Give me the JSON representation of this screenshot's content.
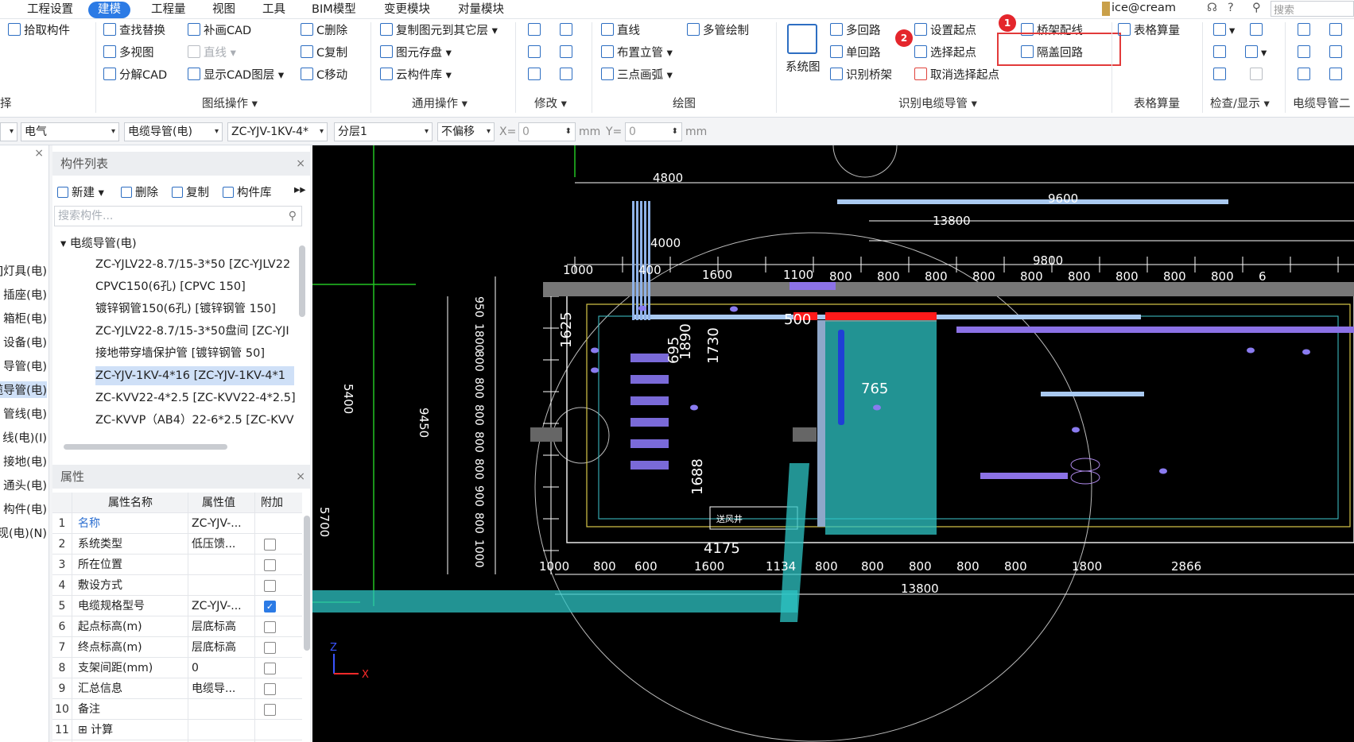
{
  "menubar": {
    "items": [
      "工程设置",
      "建模",
      "工程量",
      "视图",
      "工具",
      "BIM模型",
      "变更模块",
      "对量模块"
    ],
    "user": "ice@cream",
    "help": "?",
    "search_placeholder": "搜索"
  },
  "ribbon": {
    "pick": "拾取构件",
    "drawing_ops": {
      "find_replace": "查找替换",
      "supplement_cad": "补画CAD",
      "delete_c": "C删除",
      "multiview": "多视图",
      "line": "直线",
      "copy_c": "C复制",
      "explode_cad": "分解CAD",
      "show_cad_layer": "显示CAD图层",
      "move_c": "C移动",
      "group": "图纸操作"
    },
    "common_ops": {
      "copy_to_floor": "复制图元到其它层",
      "save_element": "图元存盘",
      "cloud_lib": "云构件库",
      "group": "通用操作"
    },
    "modify": {
      "group": "修改"
    },
    "draw": {
      "line": "直线",
      "riser": "布置立管",
      "arc": "三点画弧",
      "multi_pipe": "多管绘制",
      "group": "绘图"
    },
    "recognize": {
      "system_diagram": "系统图",
      "multi_loop": "多回路",
      "single_loop": "单回路",
      "recognize_tray": "识别桥架",
      "set_start": "设置起点",
      "select_start": "选择起点",
      "cancel_start": "取消选择起点",
      "tray_wiring": "桥架配线",
      "hidden_loop": "隔盖回路",
      "group": "识别电缆导管"
    },
    "table_calc": {
      "label": "表格算量",
      "group": "表格算量"
    },
    "check": {
      "group": "检查/显示"
    },
    "cable2": {
      "group": "电缆导管二"
    },
    "badges": [
      "1",
      "2"
    ],
    "left_group": "择"
  },
  "propbar": {
    "discipline": "电气",
    "type": "电缆导管(电)",
    "spec": "ZC-YJV-1KV-4*",
    "layer": "分层1",
    "offset": "不偏移",
    "x_label": "X=",
    "x_value": "0",
    "y_label": "Y=",
    "y_value": "0",
    "unit": "mm"
  },
  "leftstrip": [
    "]灯具(电)",
    "插座(电)",
    "箱柜(电)",
    "设备(电)",
    "导管(电)",
    "缆导管(电)",
    "管线(电)",
    "线(电)(I)",
    "接地(电)",
    "通头(电)",
    "构件(电)",
    "现(电)(N)"
  ],
  "component_list": {
    "title": "构件列表",
    "new": "新建",
    "delete": "删除",
    "copy": "复制",
    "library": "构件库",
    "search_placeholder": "搜索构件...",
    "root": "电缆导管(电)",
    "items": [
      "ZC-YJLV22-8.7/15-3*50 [ZC-YJLV22",
      "CPVC150(6孔)  [CPVC 150]",
      "镀锌钢管150(6孔)  [镀锌钢管 150]",
      "ZC-YJLV22-8.7/15-3*50盘间 [ZC-YJI",
      "接地带穿墙保护管 [镀锌钢管 50]",
      "ZC-YJV-1KV-4*16 [ZC-YJV-1KV-4*1",
      "ZC-KVV22-4*2.5 [ZC-KVV22-4*2.5]",
      "ZC-KVVP（AB4）22-6*2.5 [ZC-KVV"
    ]
  },
  "properties": {
    "title": "属性",
    "col_name": "属性名称",
    "col_value": "属性值",
    "col_extra": "附加",
    "rows": [
      {
        "n": "1",
        "k": "名称",
        "v": "ZC-YJV-...",
        "cb": null
      },
      {
        "n": "2",
        "k": "系统类型",
        "v": "低压馈...",
        "cb": false
      },
      {
        "n": "3",
        "k": "所在位置",
        "v": "",
        "cb": false
      },
      {
        "n": "4",
        "k": "敷设方式",
        "v": "",
        "cb": false
      },
      {
        "n": "5",
        "k": "电缆规格型号",
        "v": "ZC-YJV-...",
        "cb": true
      },
      {
        "n": "6",
        "k": "起点标高(m)",
        "v": "层底标高",
        "cb": false
      },
      {
        "n": "7",
        "k": "终点标高(m)",
        "v": "层底标高",
        "cb": false
      },
      {
        "n": "8",
        "k": "支架间距(mm)",
        "v": "0",
        "cb": false
      },
      {
        "n": "9",
        "k": "汇总信息",
        "v": "电缆导...",
        "cb": false
      },
      {
        "n": "10",
        "k": "备注",
        "v": "",
        "cb": false
      },
      {
        "n": "11",
        "k": "⊞ 计算",
        "v": "",
        "cb": null
      }
    ]
  },
  "canvas": {
    "dims": {
      "top": [
        "4800",
        "9600",
        "13800",
        "4000",
        "9800",
        "1000",
        "400",
        "1600",
        "1100"
      ],
      "top_small": [
        "800",
        "800",
        "800",
        "800",
        "800",
        "800",
        "800",
        "800",
        "800",
        "6"
      ],
      "bottom": [
        "1000",
        "800",
        "600",
        "1600",
        "1134",
        "800",
        "800",
        "800",
        "800",
        "800",
        "1800",
        "2866"
      ],
      "bottom_total": "13800",
      "left_big": [
        "5400",
        "9450",
        "5700"
      ],
      "left_small": [
        "950",
        "1800",
        "800",
        "800",
        "800",
        "800",
        "800",
        "900",
        "800",
        "1000"
      ],
      "middle": [
        "1625",
        "695",
        "1890",
        "1730",
        "1688",
        "4175",
        "765",
        "500"
      ]
    },
    "room_label": "送风井",
    "axis_x": "X",
    "axis_z": "Z",
    "colors": {
      "highlight_red": "#ff1a1a",
      "tray_cyan": "#2ec4c4",
      "pipe_blue": "#1f3fd6",
      "dim_white": "#ffffff",
      "grid_green": "#22c322"
    }
  }
}
